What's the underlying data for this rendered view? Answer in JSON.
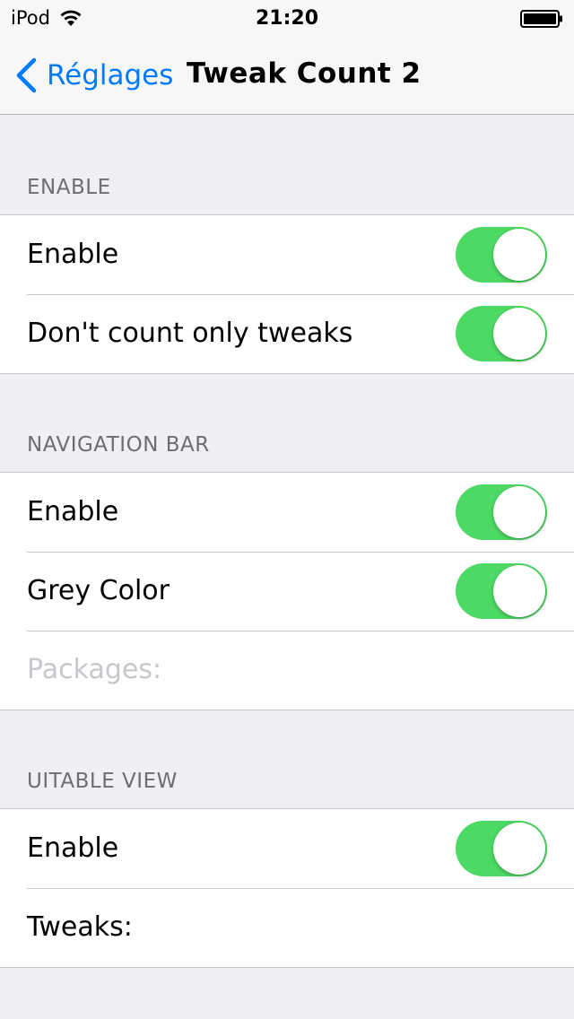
{
  "status_bar": {
    "carrier": "iPod",
    "time": "21:20"
  },
  "nav": {
    "back_label": "Réglages",
    "title": "Tweak Count 2"
  },
  "sections": [
    {
      "header": "ENABLE",
      "rows": [
        {
          "label": "Enable",
          "toggle_on": true
        },
        {
          "label": "Don't count only tweaks",
          "toggle_on": true
        }
      ]
    },
    {
      "header": "NAVIGATION BAR",
      "rows": [
        {
          "label": "Enable",
          "toggle_on": true
        },
        {
          "label": "Grey Color",
          "toggle_on": true
        },
        {
          "placeholder": "Packages:"
        }
      ]
    },
    {
      "header": "UITABLE VIEW",
      "rows": [
        {
          "label": "Enable",
          "toggle_on": true
        },
        {
          "label": "Tweaks:"
        }
      ]
    }
  ],
  "colors": {
    "accent": "#007aff",
    "toggle_on": "#4cd964",
    "background": "#efeff4"
  }
}
